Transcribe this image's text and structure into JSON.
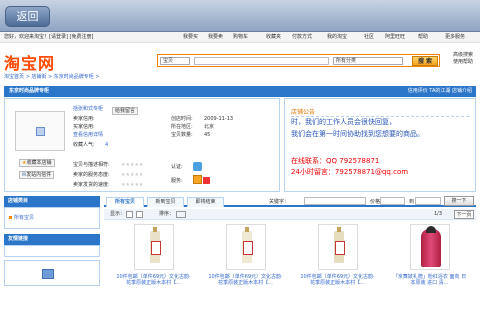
{
  "nav": {
    "back_label": "返回"
  },
  "topbar": {
    "greeting": "您好，欢迎来淘宝！[请登录] [免费注册]",
    "links": [
      "我要买",
      "我要卖",
      "购物车",
      "收藏夹",
      "付款方式",
      "我的淘宝",
      "社区",
      "阿里旺旺",
      "帮助",
      "更多服务"
    ]
  },
  "header": {
    "logo": "淘宝网",
    "search_scope": "宝贝",
    "search_category": "所有分类",
    "search_button": "搜 索",
    "advanced": [
      "高级搜索",
      "使用帮助"
    ]
  },
  "breadcrumb": "淘宝首页 > 店铺街 > 东京时尚品牌专柜 >",
  "shop": {
    "name": "东京时尚品牌专柜",
    "header_links": "信用评价   TA的江湖   店铺介绍"
  },
  "seller": {
    "name": "括张和式专柜",
    "contact": "给我留言",
    "labels": [
      "卖家信用:",
      "买家信用:",
      "查看信用详情",
      "收藏人气:"
    ],
    "popularity": "4",
    "created_label": "创店时间:",
    "created": "2009-11-13",
    "location_label": "所在地区:",
    "location": "北京",
    "items_label": "宝贝数量:",
    "items": "45",
    "fav_button": "收藏本店铺",
    "msg_button": "发站内信件",
    "ratings": [
      "宝贝与描述相符:",
      "卖家的服务态度:",
      "卖家发货的速度:"
    ],
    "stars": "★★★★★",
    "cert_label": "认证:",
    "service_label": "服务:"
  },
  "notice": {
    "title": "店铺公告",
    "line1": "时，我们的工作人员会很快回复，",
    "line2": "我们会在第一时间协助找到您想要的商品。",
    "contact": "在线联系：QQ 792578871",
    "message": "24小时留言：792578871@qq.com"
  },
  "left": {
    "category_title": "店铺类目",
    "category_item": "所有宝贝",
    "links_title": "友情链接"
  },
  "tabs": [
    "所有宝贝",
    "新到宝贝",
    "即将结束"
  ],
  "filter": {
    "keyword_label": "关键字：",
    "price_label": "价格:",
    "to": "到",
    "search_button": "搜一下"
  },
  "toolbar": {
    "show_label": "显示：",
    "sort_label": "排序：",
    "page": "1/3",
    "next": "下一页"
  },
  "products": [
    {
      "title": "10件包邮（单件69元）文化古韵·花季原装正版木本村【..."
    },
    {
      "title": "10件包邮（单件69元）文化古韵·花季原装正版木本村【..."
    },
    {
      "title": "10件包邮（单件69元）文化古韵·花季原装正版木本村【..."
    },
    {
      "title": "「京舞妓礼赠」粉红浴衣 面向 日本原装 进口 清..."
    }
  ],
  "colors": {
    "accent": "#2b76c8",
    "logo": "#ff4a00",
    "alert": "#ee0000"
  }
}
